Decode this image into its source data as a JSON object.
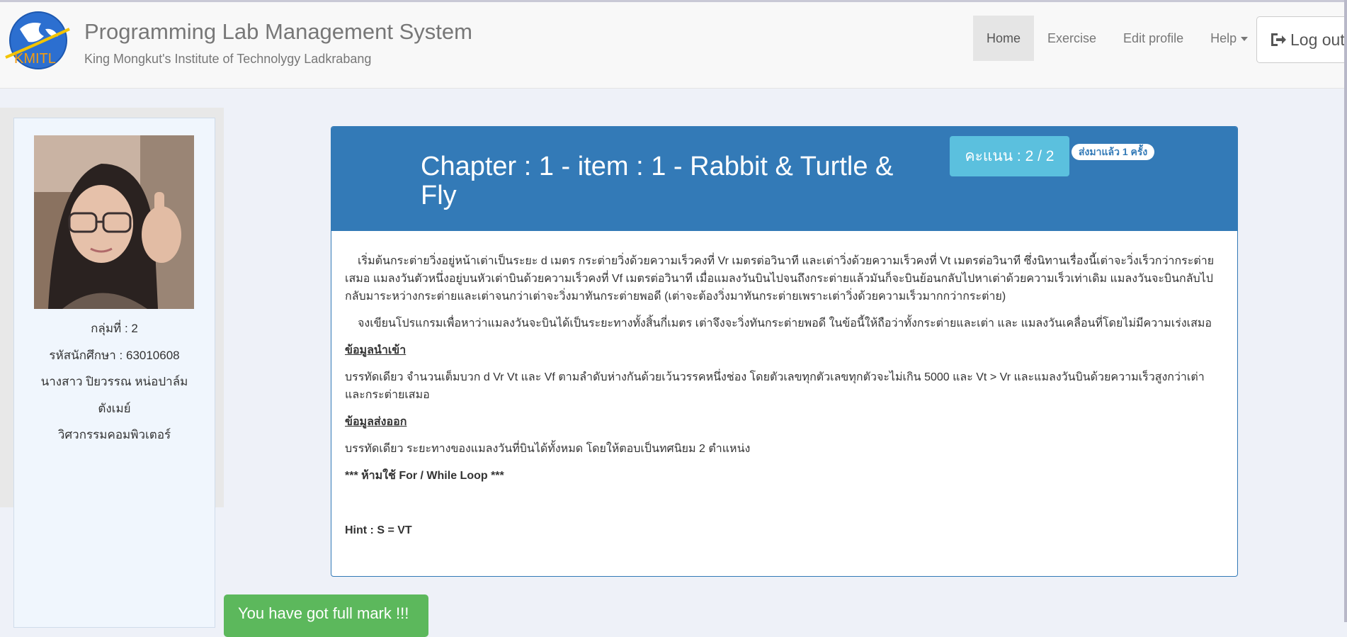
{
  "navbar": {
    "logo_text": "KMITL",
    "title": "Programming Lab Management System",
    "subtitle": "King Mongkut's Institute of Technolygy Ladkrabang",
    "items": [
      {
        "label": "Home",
        "active": true
      },
      {
        "label": "Exercise",
        "active": false
      },
      {
        "label": "Edit profile",
        "active": false
      },
      {
        "label": "Help",
        "active": false
      }
    ],
    "logout_label": "Log out"
  },
  "sidebar": {
    "group": "กลุ่มที่ : 2",
    "student_id": "รหัสนักศึกษา : 63010608",
    "name_line1": "นางสาว ปิยวรรณ หน่อปาล์ม",
    "name_line2": "ตังเมย์",
    "department": "วิศวกรรมคอมพิวเตอร์"
  },
  "problem": {
    "title": "Chapter : 1 - item : 1 - Rabbit & Turtle & Fly",
    "score": "คะแนน : 2 / 2",
    "submitted_badge": "ส่งมาแล้ว 1 ครั้ง",
    "para1": "เริ่มต้นกระต่ายวิ่งอยู่หน้าเต่าเป็นระยะ d เมตร กระต่ายวิ่งด้วยความเร็วคงที่ Vr เมตรต่อวินาที และเต่าวิ่งด้วยความเร็วคงที่ Vt เมตรต่อวินาที ซึ่งนิทานเรื่องนี้เต่าจะวิ่งเร็วกว่ากระต่ายเสมอ แมลงวันตัวหนึ่งอยู่บนหัวเต่าบินด้วยความเร็วคงที่ Vf เมตรต่อวินาที เมื่อแมลงวันบินไปจนถึงกระต่ายแล้วมันก็จะบินย้อนกลับไปหาเต่าด้วยความเร็วเท่าเดิม แมลงวันจะบินกลับไปกลับมาระหว่างกระต่ายและเต่าจนกว่าเต่าจะวิ่งมาทันกระต่ายพอดี (เต่าจะต้องวิ่งมาทันกระต่ายเพราะเต่าวิ่งด้วยความเร็วมากกว่ากระต่าย)",
    "para2": "จงเขียนโปรแกรมเพื่อหาว่าแมลงวันจะบินได้เป็นระยะทางทั้งสิ้นกี่เมตร เต่าจึงจะวิ่งทันกระต่ายพอดี ในข้อนี้ให้ถือว่าทั้งกระต่ายและเต่า และ แมลงวันเคลื่อนที่โดยไม่มีความเร่งเสมอ",
    "input_heading": "ข้อมูลนำเข้า",
    "input_text": "บรรทัดเดียว จำนวนเต็มบวก d Vr Vt และ Vf ตามลำดับห่างกันด้วยเว้นวรรคหนึ่งช่อง โดยตัวเลขทุกตัวเลขทุกตัวจะไม่เกิน 5000 และ Vt > Vr และแมลงวันบินด้วยความเร็วสูงกว่าเต่าและกระต่ายเสมอ",
    "output_heading": "ข้อมูลส่งออก",
    "output_text": "บรรทัดเดียว ระยะทางของแมลงวันที่บินได้ทั้งหมด โดยให้ตอบเป็นทศนิยม 2 ตำแหน่ง",
    "warning": "*** ห้ามใช้ For / While Loop ***",
    "hint": "Hint : S = VT"
  },
  "full_mark_label": "You have got full mark !!!"
}
